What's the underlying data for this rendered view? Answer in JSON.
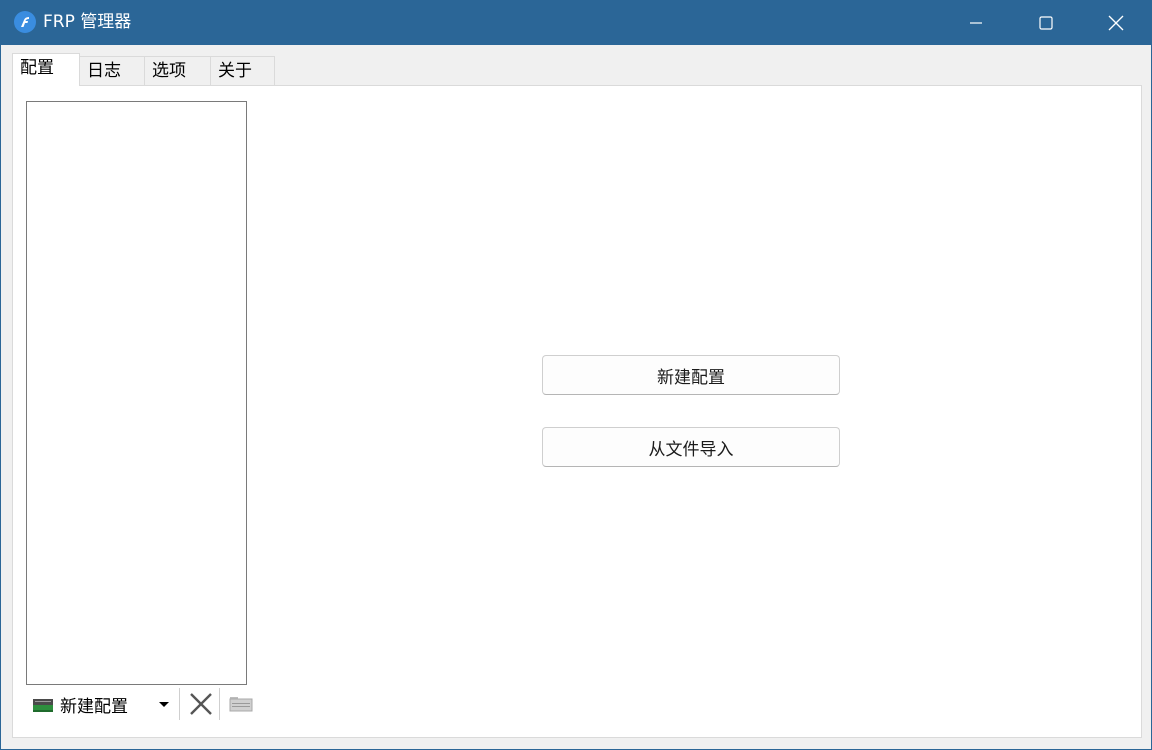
{
  "window": {
    "title": "FRP 管理器"
  },
  "tabs": [
    {
      "label": "配置",
      "active": true
    },
    {
      "label": "日志",
      "active": false
    },
    {
      "label": "选项",
      "active": false
    },
    {
      "label": "关于",
      "active": false
    }
  ],
  "main": {
    "new_config_button": "新建配置",
    "import_file_button": "从文件导入"
  },
  "toolbar": {
    "new_config_label": "新建配置",
    "icons": [
      "new-config-icon",
      "dropdown-arrow-icon",
      "delete-icon",
      "open-folder-icon"
    ]
  },
  "colors": {
    "titlebar": "#2b6697",
    "window_bg": "#f0f0f0",
    "content_bg": "#ffffff"
  }
}
